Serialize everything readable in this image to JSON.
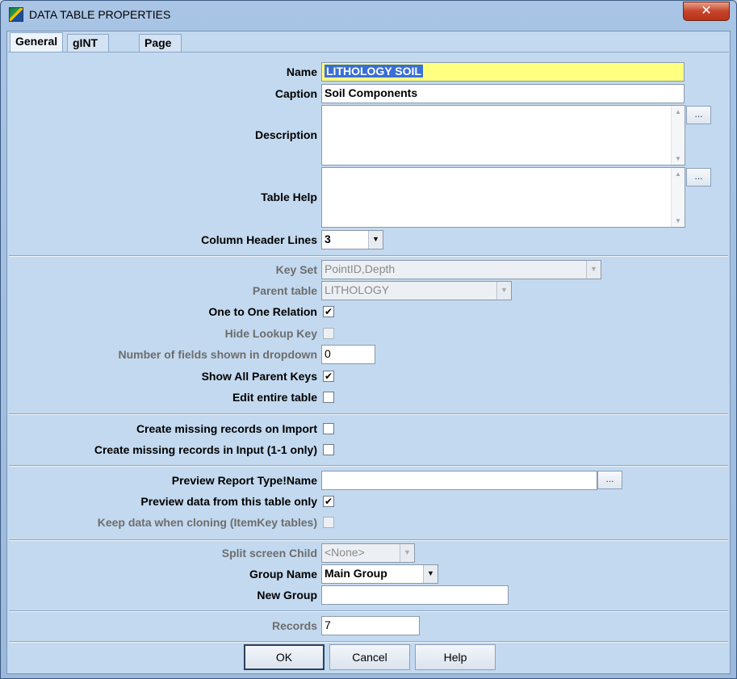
{
  "window": {
    "title": "DATA TABLE PROPERTIES",
    "close_glyph": "✕"
  },
  "tabs": [
    {
      "label": "General",
      "active": true
    },
    {
      "label": "gINT Rules"
    },
    {
      "label": "Page Setup"
    }
  ],
  "general": {
    "name": {
      "label": "Name",
      "value": "LITHOLOGY SOIL"
    },
    "caption": {
      "label": "Caption",
      "value": "Soil Components"
    },
    "description": {
      "label": "Description",
      "value": ""
    },
    "table_help": {
      "label": "Table Help",
      "value": ""
    },
    "column_header_lines": {
      "label": "Column Header Lines",
      "value": "3"
    },
    "key_set": {
      "label": "Key Set",
      "value": "PointID,Depth"
    },
    "parent_table": {
      "label": "Parent table",
      "value": "LITHOLOGY"
    },
    "one_to_one": {
      "label": "One to One Relation",
      "checked": true
    },
    "hide_lookup_key": {
      "label": "Hide Lookup Key",
      "checked": false
    },
    "num_fields_dropdown": {
      "label": "Number of fields shown in dropdown",
      "value": "0"
    },
    "show_all_parent_keys": {
      "label": "Show All Parent Keys",
      "checked": true
    },
    "edit_entire_table": {
      "label": "Edit entire table",
      "checked": false
    },
    "create_missing_import": {
      "label": "Create missing records on Import",
      "checked": false
    },
    "create_missing_input": {
      "label": "Create missing records in Input (1-1 only)",
      "checked": false
    },
    "preview_report": {
      "label": "Preview Report Type!Name",
      "value": ""
    },
    "preview_this_table": {
      "label": "Preview data from this table only",
      "checked": true
    },
    "keep_data_cloning": {
      "label": "Keep data when cloning (ItemKey tables)",
      "checked": false
    },
    "split_screen_child": {
      "label": "Split screen Child",
      "value": "<None>"
    },
    "group_name": {
      "label": "Group Name",
      "value": "Main Group"
    },
    "new_group": {
      "label": "New Group",
      "value": ""
    },
    "records": {
      "label": "Records",
      "value": "7"
    }
  },
  "buttons": {
    "ok": "OK",
    "cancel": "Cancel",
    "help": "Help",
    "ellipsis": "..."
  },
  "glyphs": {
    "check": "✔",
    "combo_arrow": "▼",
    "scroll_up": "▲",
    "scroll_down": "▼"
  }
}
